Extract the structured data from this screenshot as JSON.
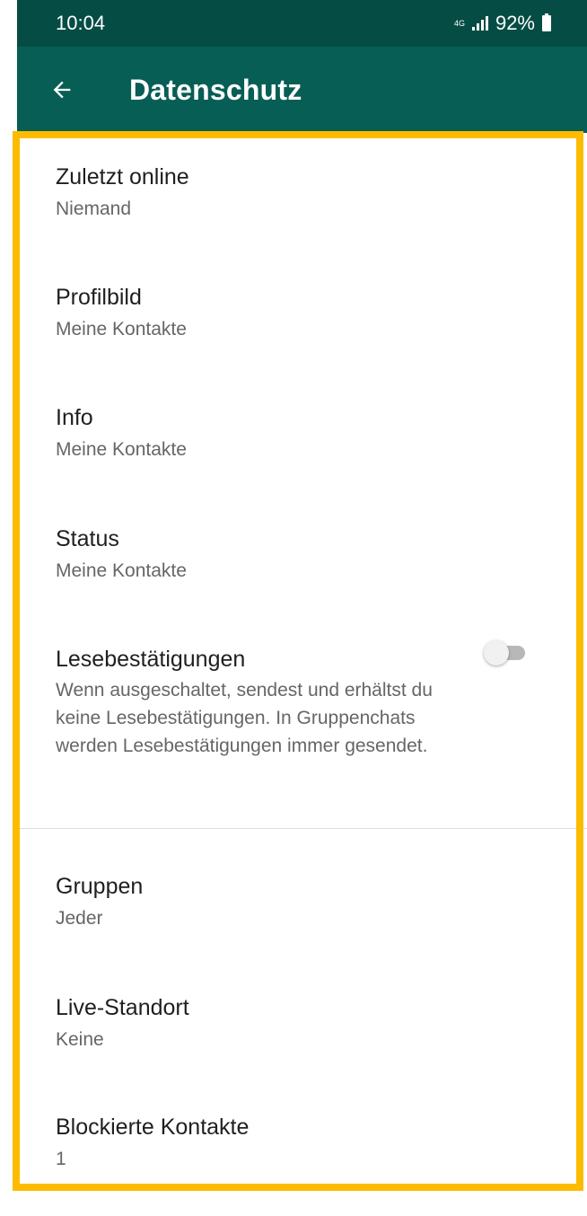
{
  "status_bar": {
    "time": "10:04",
    "network": "4G",
    "battery": "92%"
  },
  "app_bar": {
    "title": "Datenschutz",
    "back_icon": "arrow-left-icon"
  },
  "colors": {
    "status_bar_bg": "#054d44",
    "app_bar_bg": "#075e54",
    "highlight": "#fdbb00"
  },
  "settings": {
    "last_seen": {
      "title": "Zuletzt online",
      "value": "Niemand"
    },
    "profile_photo": {
      "title": "Profilbild",
      "value": "Meine Kontakte"
    },
    "about": {
      "title": "Info",
      "value": "Meine Kontakte"
    },
    "status": {
      "title": "Status",
      "value": "Meine Kontakte"
    },
    "read_receipts": {
      "title": "Lesebestätigungen",
      "description": "Wenn ausgeschaltet, sendest und erhältst du keine Lesebestätigungen. In Gruppenchats werden Lesebestätigungen immer gesendet.",
      "enabled": false
    },
    "groups": {
      "title": "Gruppen",
      "value": "Jeder"
    },
    "live_location": {
      "title": "Live-Standort",
      "value": "Keine"
    },
    "blocked_contacts": {
      "title": "Blockierte Kontakte",
      "value": "1"
    }
  }
}
